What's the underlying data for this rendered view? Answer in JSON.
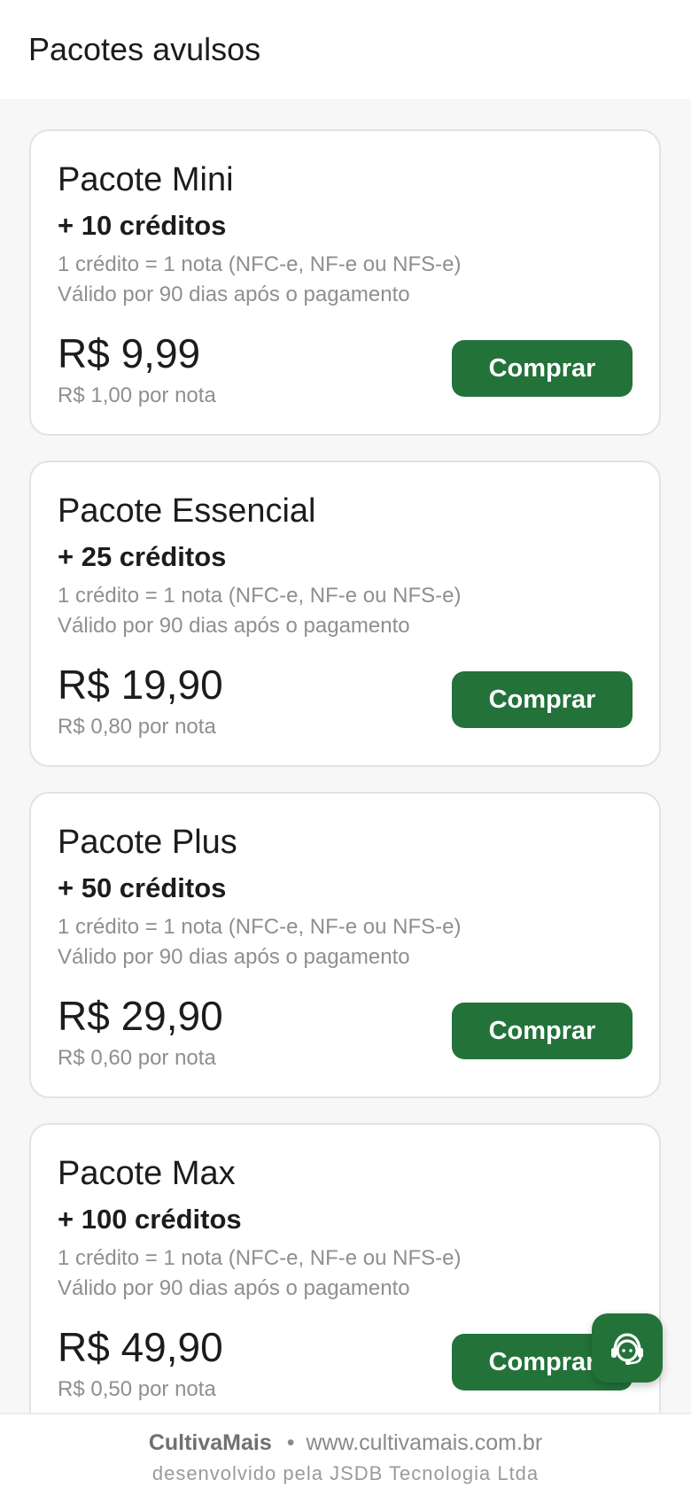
{
  "header": {
    "title": "Pacotes avulsos"
  },
  "packages": [
    {
      "name": "Pacote Mini",
      "credits": "+ 10 créditos",
      "desc_line1": "1 crédito = 1 nota (NFC-e, NF-e ou NFS-e)",
      "desc_line2": "Válido por 90 dias após o pagamento",
      "price": "R$ 9,99",
      "unit_price": "R$ 1,00 por nota",
      "button_label": "Comprar"
    },
    {
      "name": "Pacote Essencial",
      "credits": "+ 25 créditos",
      "desc_line1": "1 crédito = 1 nota (NFC-e, NF-e ou NFS-e)",
      "desc_line2": "Válido por 90 dias após o pagamento",
      "price": "R$ 19,90",
      "unit_price": "R$ 0,80 por nota",
      "button_label": "Comprar"
    },
    {
      "name": "Pacote Plus",
      "credits": "+ 50 créditos",
      "desc_line1": "1 crédito = 1 nota (NFC-e, NF-e ou NFS-e)",
      "desc_line2": "Válido por 90 dias após o pagamento",
      "price": "R$ 29,90",
      "unit_price": "R$ 0,60 por nota",
      "button_label": "Comprar"
    },
    {
      "name": "Pacote Max",
      "credits": "+ 100 créditos",
      "desc_line1": "1 crédito = 1 nota (NFC-e, NF-e ou NFS-e)",
      "desc_line2": "Válido por 90 dias após o pagamento",
      "price": "R$ 49,90",
      "unit_price": "R$ 0,50 por nota",
      "button_label": "Comprar"
    }
  ],
  "fab": {
    "icon": "support-agent-icon"
  },
  "footer": {
    "brand": "CultivaMais",
    "separator": "•",
    "website": "www.cultivamais.com.br",
    "credit": "desenvolvido pela JSDB Tecnologia Ltda"
  },
  "colors": {
    "primary": "#23723a",
    "background": "#f7f7f7",
    "card": "#ffffff",
    "muted_text": "#8f8f8f"
  }
}
